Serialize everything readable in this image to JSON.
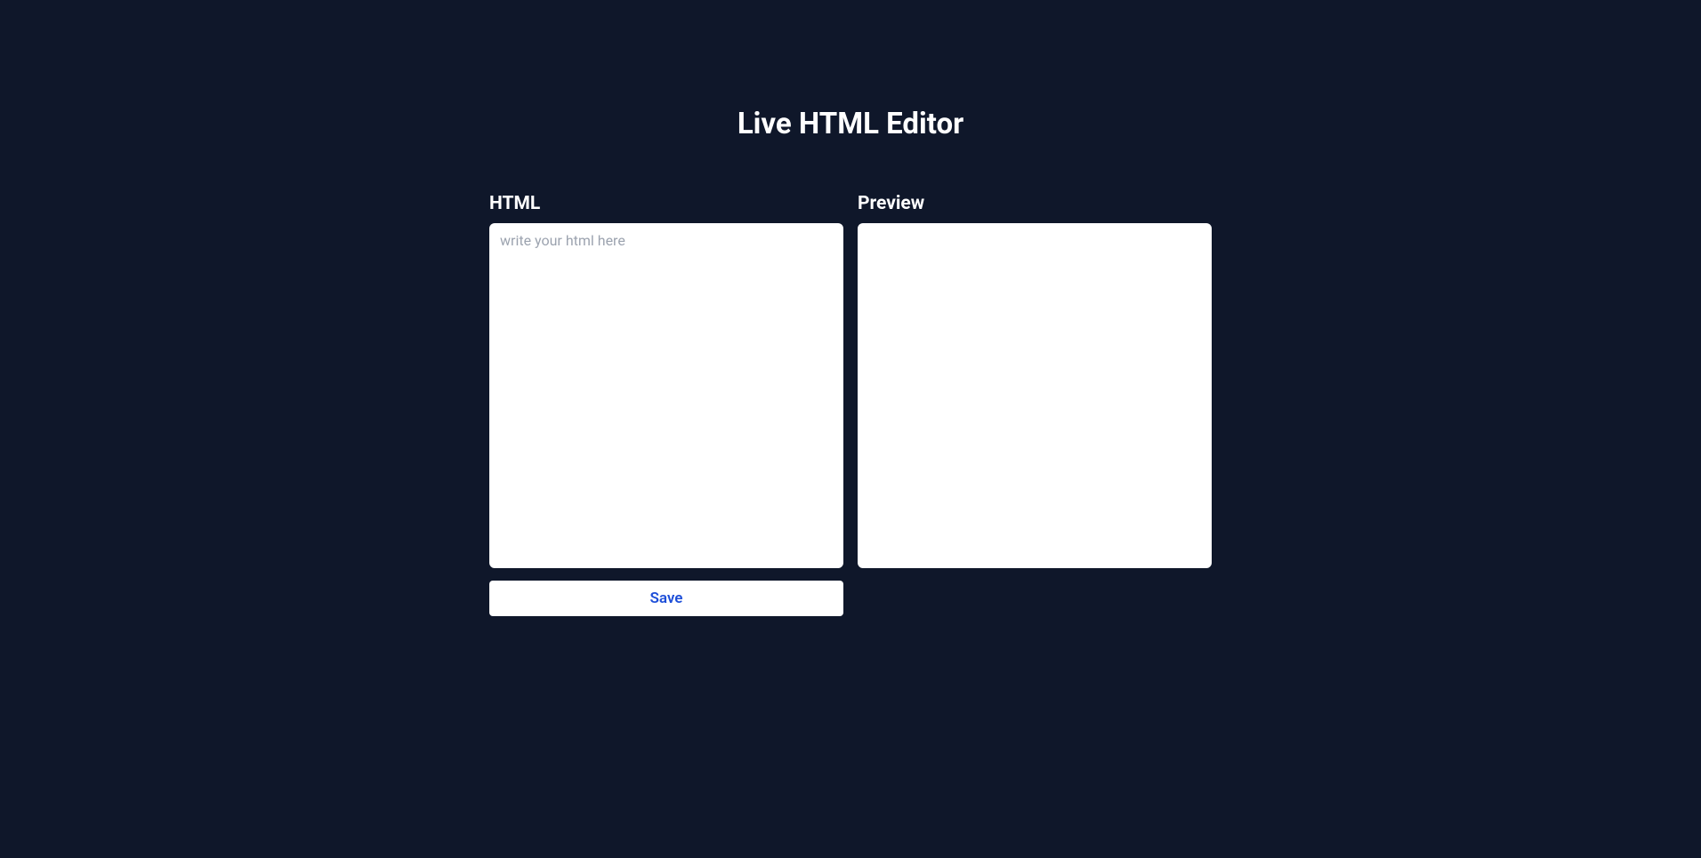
{
  "title": "Live HTML Editor",
  "editor": {
    "html_label": "HTML",
    "html_placeholder": "write your html here",
    "html_value": "",
    "preview_label": "Preview",
    "save_label": "Save"
  }
}
